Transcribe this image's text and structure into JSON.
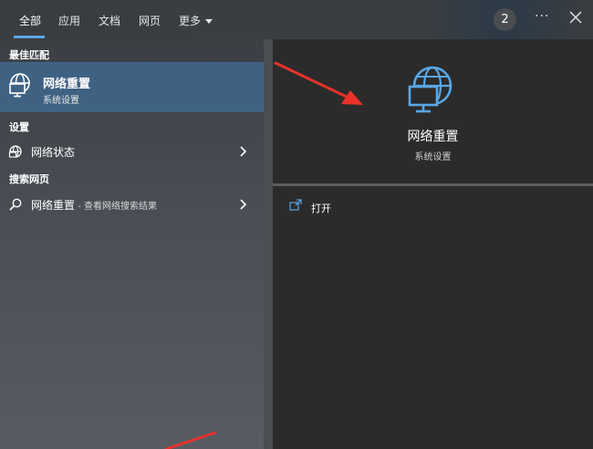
{
  "tabs": [
    {
      "label": "全部"
    },
    {
      "label": "应用"
    },
    {
      "label": "文档"
    },
    {
      "label": "网页"
    },
    {
      "label": "更多"
    }
  ],
  "topbar": {
    "badge": "2",
    "more_icon": "ellipsis-icon",
    "close_icon": "close-icon"
  },
  "left": {
    "best_match_label": "最佳匹配",
    "best_match": {
      "title": "网络重置",
      "subtitle": "系统设置",
      "icon": "globe-monitor-icon"
    },
    "settings_label": "设置",
    "settings_items": [
      {
        "label": "网络状态",
        "icon": "globe-icon"
      }
    ],
    "web_label": "搜索网页",
    "web_items": [
      {
        "label": "网络重置",
        "suffix": " - 查看网络搜索结果",
        "icon": "search-icon"
      }
    ]
  },
  "right": {
    "title": "网络重置",
    "subtitle": "系统设置",
    "open_label": "打开",
    "icon": "globe-monitor-icon"
  },
  "colors": {
    "accent": "#5aa7e6",
    "selected": "#3f6283",
    "arrow": "#e8322b"
  }
}
